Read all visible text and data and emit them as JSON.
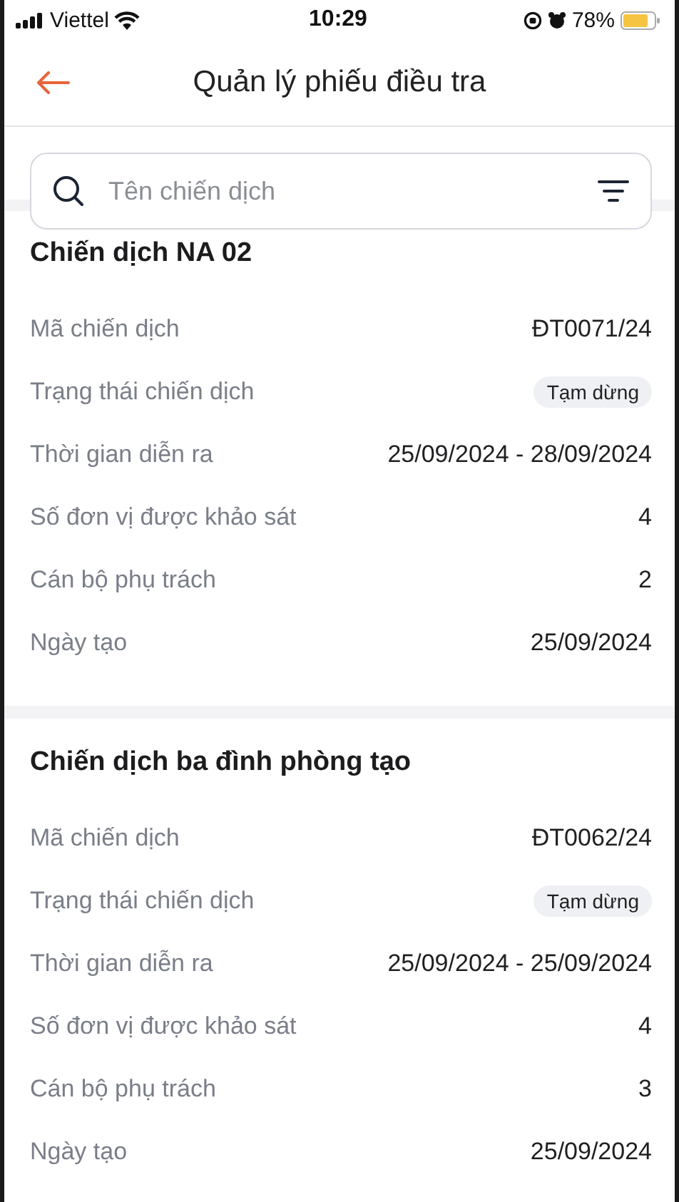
{
  "status_bar": {
    "carrier": "Viettel",
    "time": "10:29",
    "battery": "78%"
  },
  "header": {
    "title": "Quản lý phiếu điều tra"
  },
  "search": {
    "placeholder": "Tên chiến dịch"
  },
  "campaigns": [
    {
      "title": "Chiến dịch NA 02",
      "rows": [
        {
          "label": "Mã chiến dịch",
          "value": "ĐT0071/24",
          "kind": "text"
        },
        {
          "label": "Trạng thái chiến dịch",
          "value": "Tạm dừng",
          "kind": "badge"
        },
        {
          "label": "Thời gian diễn ra",
          "value": "25/09/2024 - 28/09/2024",
          "kind": "text"
        },
        {
          "label": "Số đơn vị được khảo sát",
          "value": "4",
          "kind": "text"
        },
        {
          "label": "Cán bộ phụ trách",
          "value": "2",
          "kind": "text"
        },
        {
          "label": "Ngày tạo",
          "value": "25/09/2024",
          "kind": "text"
        }
      ]
    },
    {
      "title": "Chiến dịch ba đình phòng tạo",
      "rows": [
        {
          "label": "Mã chiến dịch",
          "value": "ĐT0062/24",
          "kind": "text"
        },
        {
          "label": "Trạng thái chiến dịch",
          "value": "Tạm dừng",
          "kind": "badge"
        },
        {
          "label": "Thời gian diễn ra",
          "value": "25/09/2024 - 25/09/2024",
          "kind": "text"
        },
        {
          "label": "Số đơn vị được khảo sát",
          "value": "4",
          "kind": "text"
        },
        {
          "label": "Cán bộ phụ trách",
          "value": "3",
          "kind": "text"
        },
        {
          "label": "Ngày tạo",
          "value": "25/09/2024",
          "kind": "text"
        }
      ]
    }
  ]
}
